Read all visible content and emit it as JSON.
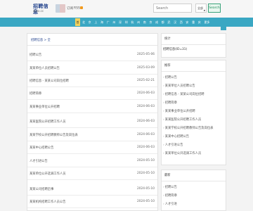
{
  "header": {
    "logo_title": "招聘信息",
    "logo_sub": "zpxx.cc",
    "link1": "订阅",
    "rss_label": "RSS"
  },
  "search": {
    "placeholder": "Search",
    "select_value": "全部",
    "button_label": "Search"
  },
  "nav": {
    "home_label": "首",
    "items": [
      "北",
      "京",
      "上",
      "海",
      "广",
      "州",
      "深",
      "圳",
      "杭",
      "州",
      "南",
      "京",
      "成",
      "都",
      "武",
      "汉",
      "西",
      "安",
      "重",
      "庆"
    ],
    "more": "更多"
  },
  "breadcrumb": "招聘信息 > 全",
  "list": [
    {
      "title": "招聘公告",
      "date": "2025-05-06"
    },
    {
      "title": "某某单位人员招聘公告",
      "date": "2025-03-09"
    },
    {
      "title": "招聘信息 - 某某公司岗位招聘",
      "date": "2025-02-21"
    },
    {
      "title": "招聘简章",
      "date": "2024-06-03"
    },
    {
      "title": "某某事业单位公开招聘",
      "date": "2024-06-03"
    },
    {
      "title": "某某医院公开招聘工作人员",
      "date": "2024-06-03"
    },
    {
      "title": "某某学校公开招聘教师公告及岗位表",
      "date": "2024-06-03"
    },
    {
      "title": "某某中心招聘公告",
      "date": "2024-06-03"
    },
    {
      "title": "人才引进公告",
      "date": "2024-05-10"
    },
    {
      "title": "某某单位公开选调工作人员",
      "date": "2024-05-10"
    },
    {
      "title": "某某公司招聘启事",
      "date": "2024-05-10"
    },
    {
      "title": "某某机构招聘工作人员公告",
      "date": "2024-05-10"
    }
  ],
  "side1": {
    "title": "统计",
    "value": "招聘信息(ID=31)"
  },
  "side2": {
    "title": "推荐",
    "items": [
      "招聘公告",
      "某某单位人员招聘公告",
      "招聘信息 - 某某公司岗位招聘",
      "招聘简章",
      "某某事业单位公开招聘",
      "某某医院公开招聘工作人员",
      "某某学校公开招聘教师公告及岗位表",
      "某某中心招聘公告",
      "人才引进公告",
      "某某单位公开选调工作人员"
    ]
  },
  "side3": {
    "title": "最新",
    "items": [
      "招聘公告",
      "招聘简章",
      "人才引进"
    ]
  }
}
